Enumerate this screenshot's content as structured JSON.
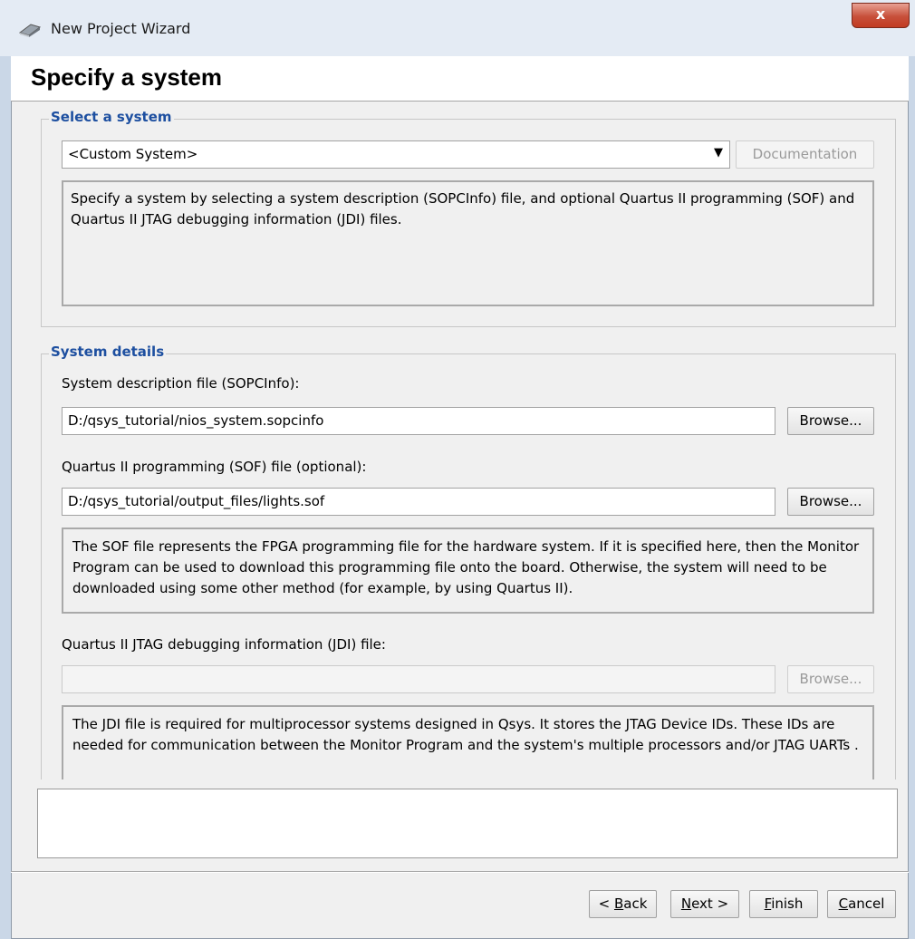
{
  "window": {
    "title": "New Project Wizard",
    "close_label": "x"
  },
  "header": {
    "title": "Specify a system"
  },
  "select_system": {
    "group_label": "Select a system",
    "selected": "<Custom System>",
    "documentation_label": "Documentation",
    "description": "Specify a system by selecting a system description (SOPCInfo) file, and optional Quartus II programming (SOF) and Quartus II JTAG debugging information (JDI) files."
  },
  "system_details": {
    "group_label": "System details",
    "sopcinfo": {
      "label": "System description file (SOPCInfo):",
      "value": "D:/qsys_tutorial/nios_system.sopcinfo",
      "browse_label": "Browse..."
    },
    "sof": {
      "label": "Quartus II programming (SOF) file (optional):",
      "value": "D:/qsys_tutorial/output_files/lights.sof",
      "browse_label": "Browse...",
      "description": "The SOF file represents the FPGA programming file for the hardware system. If it is specified here, then the Monitor Program can be used to download this programming file onto the board. Otherwise, the system will need to be downloaded using some other method (for example, by using Quartus II)."
    },
    "jdi": {
      "label": "Quartus II JTAG debugging information (JDI) file:",
      "value": "",
      "browse_label": "Browse...",
      "description": "The JDI file is required for multiprocessor systems designed in Qsys. It stores the JTAG Device IDs. These IDs are needed for communication between the Monitor Program and the system's multiple processors and/or JTAG UARTs ."
    }
  },
  "message_panel": {
    "text": ""
  },
  "footer": {
    "back": {
      "prefix": "< ",
      "mnemonic": "B",
      "rest": "ack"
    },
    "next": {
      "mnemonic": "N",
      "rest": "ext >"
    },
    "finish": {
      "mnemonic": "F",
      "rest": "inish"
    },
    "cancel": {
      "mnemonic": "C",
      "rest": "ancel"
    }
  },
  "colors": {
    "legend_blue": "#1d4fa0",
    "dialog_bg": "#f0f0f0",
    "close_red": "#c23b22"
  },
  "icons": {
    "app": "wizard-app-icon",
    "dropdown": "triangle-down"
  }
}
